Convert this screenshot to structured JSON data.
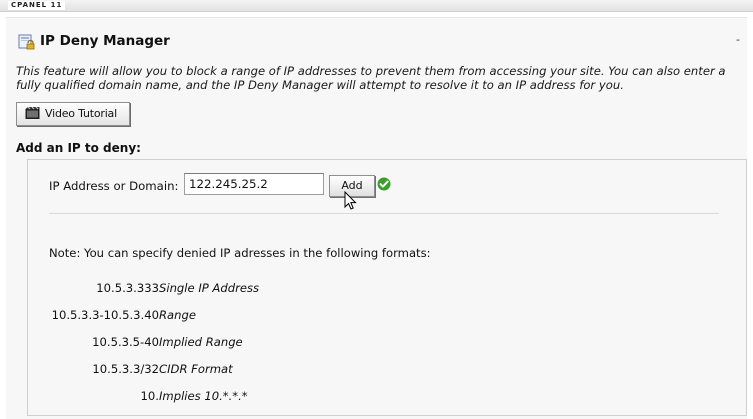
{
  "app": {
    "brand": "CPANEL 11",
    "collapse_glyph": "-"
  },
  "page": {
    "title": "IP Deny Manager",
    "title_icon": "ip-deny-lock-icon",
    "description": "This feature will allow you to block a range of IP addresses to prevent them from accessing your site. You can also enter a fully qualified domain name, and the IP Deny Manager will attempt to resolve it to an IP address for you.",
    "video_button": {
      "label": "Video Tutorial",
      "icon": "film-icon"
    }
  },
  "deny_form": {
    "heading": "Add an IP to deny:",
    "field_label": "IP Address or Domain:",
    "field_value": "122.245.25.2",
    "add_button": "Add",
    "status_icon": "check-icon",
    "note": "Note: You can specify denied IP adresses in the following formats:",
    "formats": [
      {
        "address": "10.5.3.333",
        "description": "Single IP Address"
      },
      {
        "address": "10.5.3.3-10.5.3.40",
        "description": "Range"
      },
      {
        "address": "10.5.3.5-40",
        "description": "Implied Range"
      },
      {
        "address": "10.5.3.3/32",
        "description": "CIDR Format"
      },
      {
        "address": "10.",
        "description": "Implies 10.*.*.*"
      }
    ]
  },
  "colors": {
    "check_green": "#3aa02c",
    "panel_bg": "#f7f7f7",
    "border": "#cfcfcf"
  }
}
